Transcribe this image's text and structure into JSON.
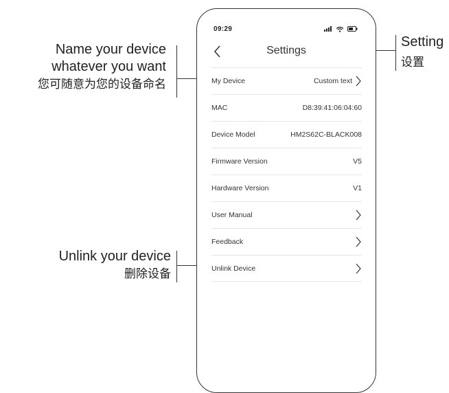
{
  "status_bar": {
    "time": "09:29",
    "icons": [
      "signal-icon",
      "wifi-icon",
      "battery-icon"
    ]
  },
  "header": {
    "title": "Settings",
    "back_icon": "chevron-left-icon"
  },
  "settings_list": [
    {
      "label": "My Device",
      "value": "Custom text",
      "chevron": true
    },
    {
      "label": "MAC",
      "value": "D8:39:41:06:04:60",
      "chevron": false
    },
    {
      "label": "Device Model",
      "value": "HM2S62C-BLACK008",
      "chevron": false
    },
    {
      "label": "Firmware Version",
      "value": "V5",
      "chevron": false
    },
    {
      "label": "Hardware Version",
      "value": "V1",
      "chevron": false
    },
    {
      "label": "User Manual",
      "value": "",
      "chevron": true
    },
    {
      "label": "Feedback",
      "value": "",
      "chevron": true
    },
    {
      "label": "Unlink Device",
      "value": "",
      "chevron": true
    }
  ],
  "annotations": {
    "name_device": {
      "line1": "Name your device",
      "line2": "whatever you want",
      "line3": "您可随意为您的设备命名"
    },
    "unlink_device": {
      "line1": "Unlink your device",
      "line2": "删除设备"
    },
    "setting": {
      "line1": "Setting",
      "line2": "设置"
    }
  },
  "colors": {
    "outline": "#333333",
    "divider": "#e6e6e6",
    "text": "#222222"
  }
}
